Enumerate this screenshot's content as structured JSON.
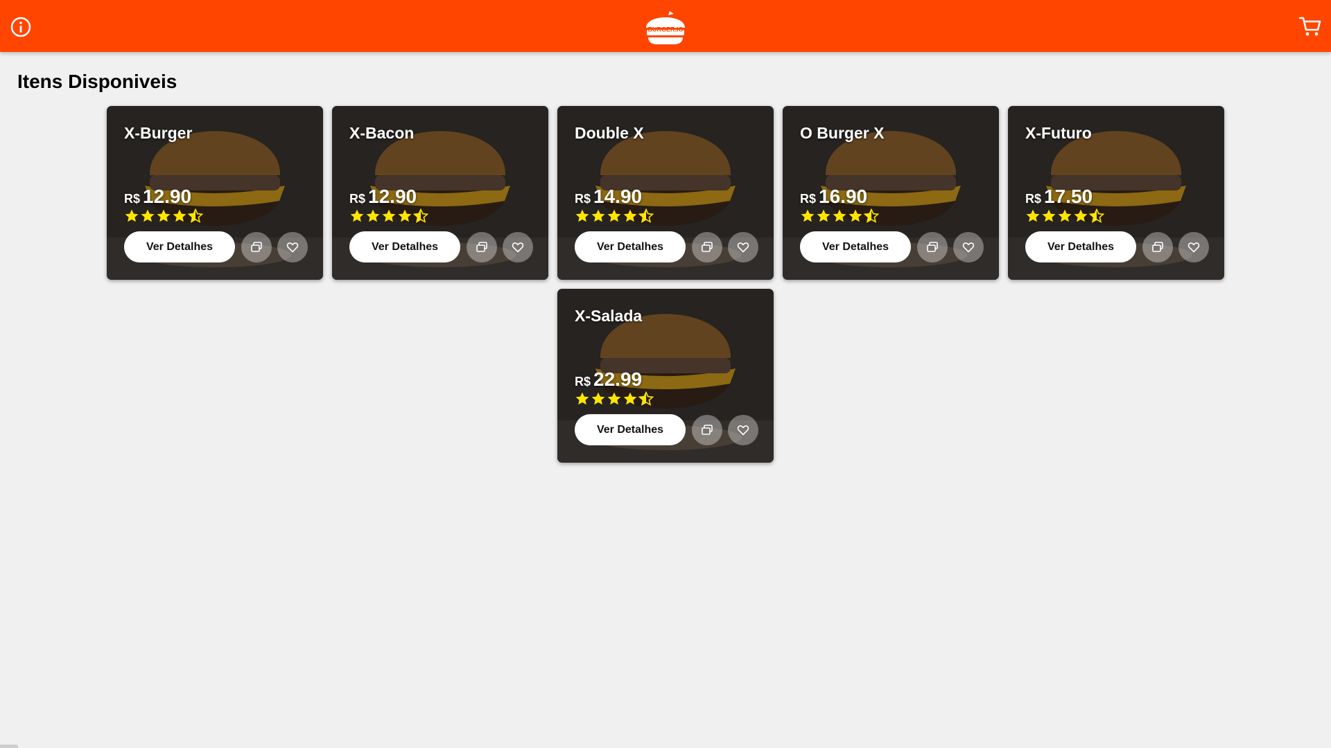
{
  "header": {
    "brand_color": "#ff4500",
    "logo_text": "BURGER.IO",
    "info_icon": "info-icon",
    "cart_icon": "cart-icon"
  },
  "main": {
    "title": "Itens Disponiveis"
  },
  "products": [
    {
      "name": "X-Burger",
      "currency": "R$",
      "price": "12.90",
      "rating": 4.5,
      "details_label": "Ver Detalhes"
    },
    {
      "name": "X-Bacon",
      "currency": "R$",
      "price": "12.90",
      "rating": 4.5,
      "details_label": "Ver Detalhes"
    },
    {
      "name": "Double X",
      "currency": "R$",
      "price": "14.90",
      "rating": 4.5,
      "details_label": "Ver Detalhes"
    },
    {
      "name": "O Burger X",
      "currency": "R$",
      "price": "16.90",
      "rating": 4.5,
      "details_label": "Ver Detalhes"
    },
    {
      "name": "X-Futuro",
      "currency": "R$",
      "price": "17.50",
      "rating": 4.5,
      "details_label": "Ver Detalhes"
    },
    {
      "name": "X-Salada",
      "currency": "R$",
      "price": "22.99",
      "rating": 4.5,
      "details_label": "Ver Detalhes"
    }
  ],
  "colors": {
    "star": "#ffe600",
    "page_bg": "#f0f0f0"
  }
}
